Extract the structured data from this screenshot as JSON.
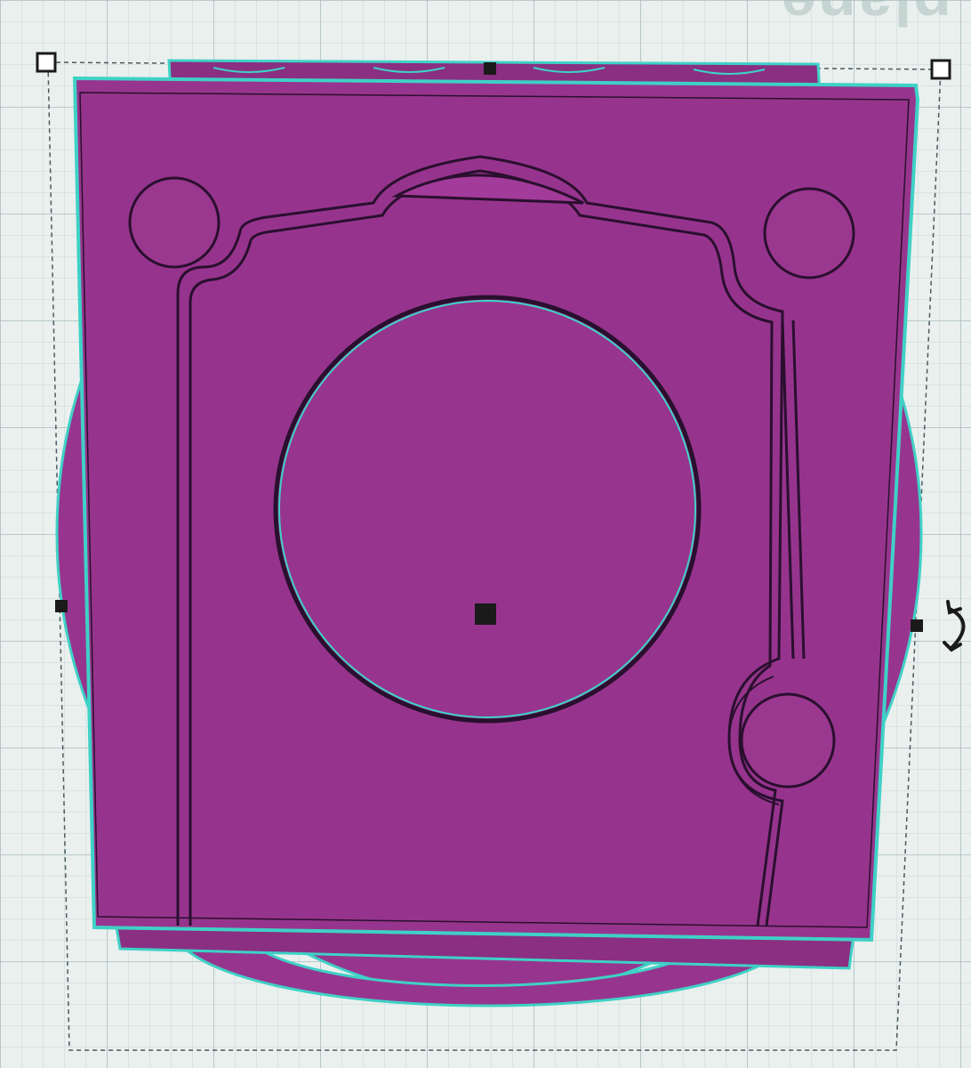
{
  "workplane": {
    "label": "plane"
  },
  "colors": {
    "grid_background": "#e9f0ee",
    "grid_minor": "#c9d7d8",
    "grid_major": "#a9bcc0",
    "shape_fill": "#97358e",
    "shape_fill_dark": "#7a2a74",
    "selection_outline": "#3fd1c6",
    "engraving": "#2a0f2e",
    "handle": "#1a1a1a"
  },
  "icons": {
    "rotate": "rotate-arrows-icon"
  }
}
